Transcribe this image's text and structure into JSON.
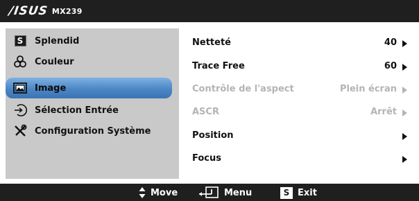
{
  "header": {
    "brand": "/ISUS",
    "model": "MX239"
  },
  "sidebar": {
    "items": [
      {
        "label": "Splendid",
        "icon": "splendid-s-icon"
      },
      {
        "label": "Couleur",
        "icon": "color-circles-icon"
      },
      {
        "label": "Image",
        "icon": "image-icon",
        "active": true
      },
      {
        "label": "Sélection Entrée",
        "icon": "input-select-icon"
      },
      {
        "label": "Configuration Système",
        "icon": "tools-icon"
      }
    ]
  },
  "panel": {
    "items": [
      {
        "label": "Netteté",
        "value": "40",
        "enabled": true
      },
      {
        "label": "Trace Free",
        "value": "60",
        "enabled": true
      },
      {
        "label": "Contrôle de l'aspect",
        "value": "Plein écran",
        "enabled": false
      },
      {
        "label": "ASCR",
        "value": "Arrêt",
        "enabled": false
      },
      {
        "label": "Position",
        "value": "",
        "enabled": true
      },
      {
        "label": "Focus",
        "value": "",
        "enabled": true
      }
    ]
  },
  "footer": {
    "move": "Move",
    "menu": "Menu",
    "exit_key": "S",
    "exit": "Exit"
  },
  "colors": {
    "bar": "#1f1f1f",
    "sidebar": "#c9c9c9",
    "active": "#4d86c4",
    "disabled_text": "#b4b4b4"
  }
}
